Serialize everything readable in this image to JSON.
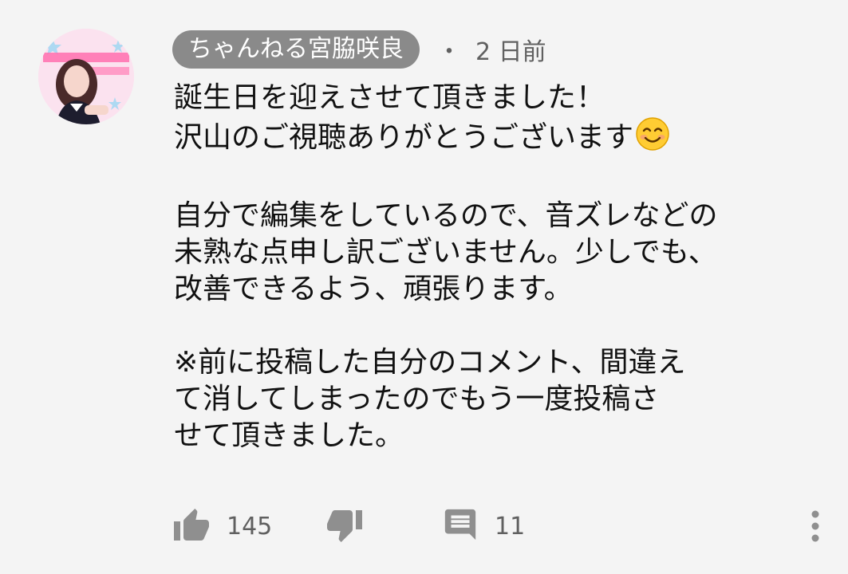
{
  "comment": {
    "author": "ちゃんねる宮脇咲良",
    "separator": "・",
    "timestamp": "2 日前",
    "paragraphs": [
      [
        "誕生日を迎えさせて頂きました！",
        "沢山のご視聴ありがとうございます"
      ],
      [
        "自分で編集をしているので、音ズレなどの",
        "未熟な点申し訳ございません。少しでも、",
        "改善できるよう、頑張ります。"
      ],
      [
        "※前に投稿した自分のコメント、間違え",
        "て消してしまったのでもう一度投稿さ",
        "せて頂きました。"
      ]
    ],
    "emoji_icon": "smiling-face-emoji",
    "avatar_icon": "channel-avatar-image"
  },
  "actions": {
    "like_icon": "thumbs-up-icon",
    "like_count": "145",
    "dislike_icon": "thumbs-down-icon",
    "reply_icon": "comment-reply-icon",
    "reply_count": "11",
    "more_icon": "more-vertical-icon"
  },
  "colors": {
    "background": "#f4f4f4",
    "author_chip": "#8a8a8a",
    "secondary_text": "#606060",
    "icon": "#8f8f8f"
  }
}
